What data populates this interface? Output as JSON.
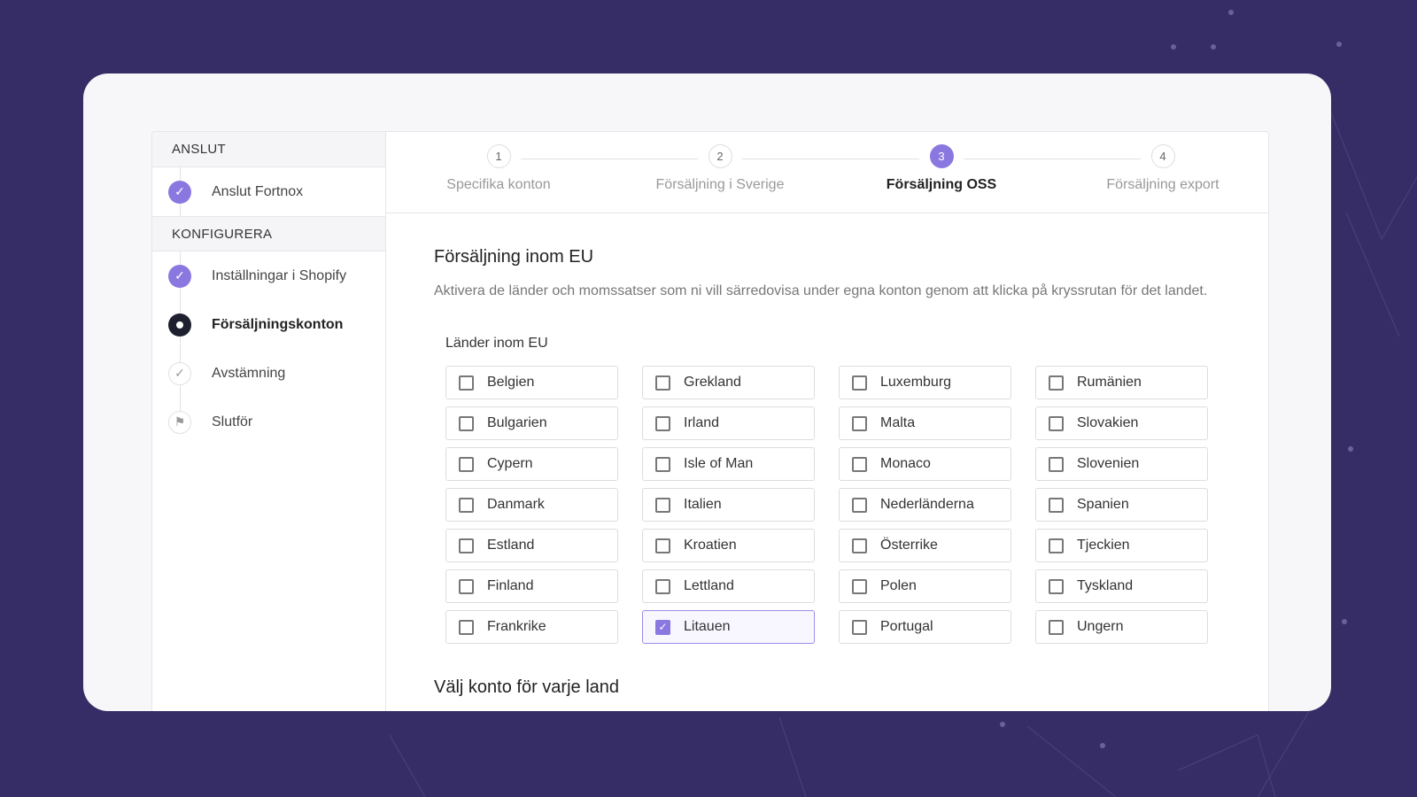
{
  "colors": {
    "background": "#372d66",
    "accent": "#8a78e0"
  },
  "sidebar": {
    "sections": [
      {
        "title": "ANSLUT",
        "items": [
          {
            "label": "Anslut Fortnox",
            "state": "done",
            "icon": "check-icon"
          }
        ]
      },
      {
        "title": "KONFIGURERA",
        "items": [
          {
            "label": "Inställningar i Shopify",
            "state": "done",
            "icon": "check-icon"
          },
          {
            "label": "Försäljningskonton",
            "state": "current",
            "icon": "current-dot-icon"
          },
          {
            "label": "Avstämning",
            "state": "todo",
            "icon": "check-icon"
          },
          {
            "label": "Slutför",
            "state": "todo",
            "icon": "flag-icon"
          }
        ]
      }
    ]
  },
  "stepper": {
    "steps": [
      {
        "num": "1",
        "label": "Specifika konton"
      },
      {
        "num": "2",
        "label": "Försäljning i Sverige"
      },
      {
        "num": "3",
        "label": "Försäljning OSS",
        "current": true
      },
      {
        "num": "4",
        "label": "Försäljning export"
      }
    ]
  },
  "main": {
    "title": "Försäljning inom EU",
    "description": "Aktivera de länder och momssatser som ni vill särredovisa under egna konton genom att klicka på kryssrutan för det landet.",
    "countries_label": "Länder inom EU",
    "countries": [
      [
        "Belgien",
        "Bulgarien",
        "Cypern",
        "Danmark",
        "Estland",
        "Finland",
        "Frankrike"
      ],
      [
        "Grekland",
        "Irland",
        "Isle of Man",
        "Italien",
        "Kroatien",
        "Lettland",
        "Litauen"
      ],
      [
        "Luxemburg",
        "Malta",
        "Monaco",
        "Nederländerna",
        "Österrike",
        "Polen",
        "Portugal"
      ],
      [
        "Rumänien",
        "Slovakien",
        "Slovenien",
        "Spanien",
        "Tjeckien",
        "Tyskland",
        "Ungern"
      ]
    ],
    "checked": [
      "Litauen"
    ],
    "next_title": "Välj konto för varje land"
  }
}
